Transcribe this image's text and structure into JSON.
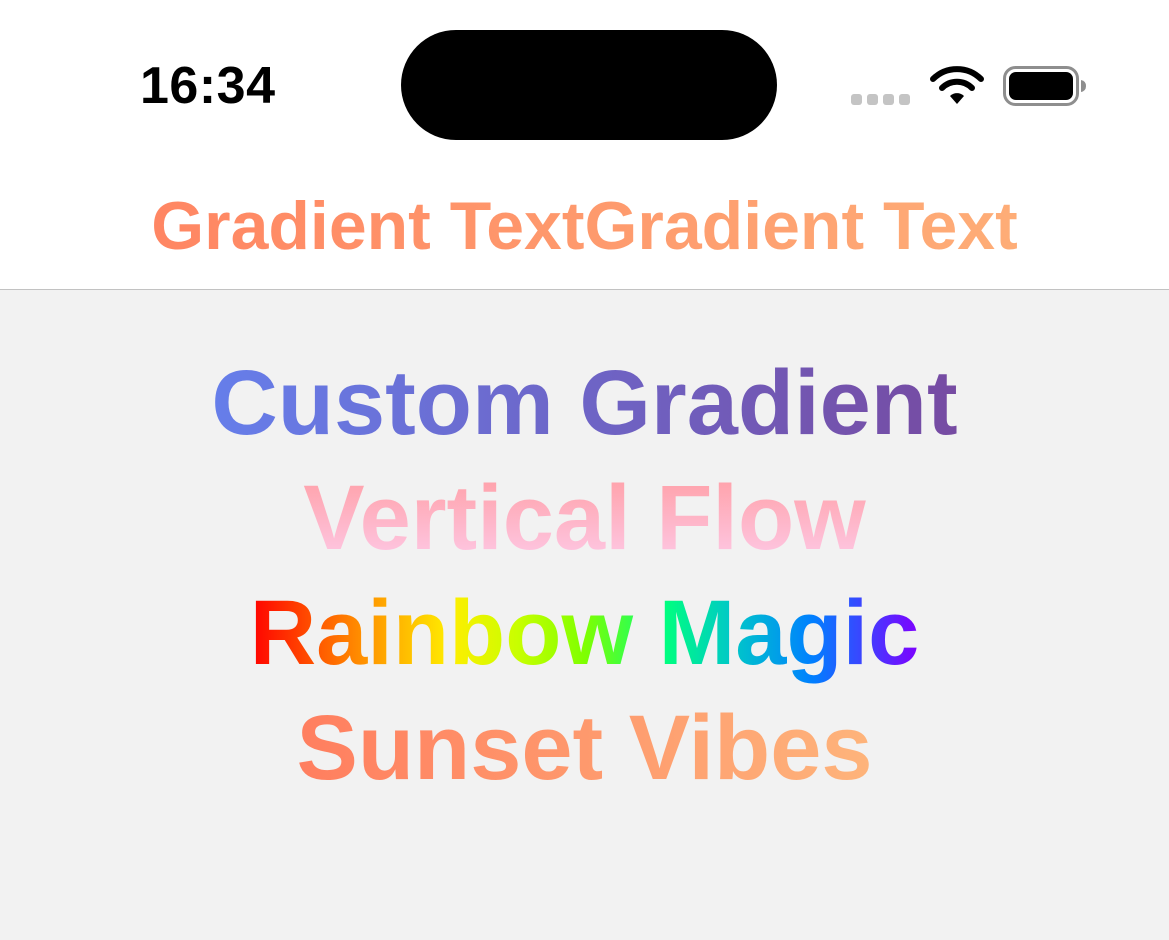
{
  "status_bar": {
    "time": "16:34"
  },
  "nav": {
    "title": "Gradient TextGradient Text"
  },
  "lines": [
    {
      "text": "Custom Gradient",
      "style": "horizontal",
      "colors": [
        "#667eea",
        "#764ba2"
      ]
    },
    {
      "text": "Vertical Flow",
      "style": "vertical",
      "colors": [
        "#ff9a9e",
        "#fecfef"
      ]
    },
    {
      "text": "Rainbow Magic",
      "style": "horizontal",
      "colors": [
        "#ff0000",
        "#ff8a00",
        "#ffee00",
        "#7fff00",
        "#00ff7f",
        "#0080ff",
        "#7f00ff"
      ]
    },
    {
      "text": "Sunset Vibes",
      "style": "horizontal",
      "colors": [
        "#ff7e5f",
        "#feb47b"
      ]
    }
  ],
  "colors": {
    "nav_gradient": [
      "#ff7f5f",
      "#feb47b"
    ],
    "content_background": "#f2f2f2",
    "header_background": "#ffffff"
  },
  "icons": {
    "signal": "cellular-signal-icon",
    "wifi": "wifi-icon",
    "battery": "battery-icon"
  }
}
